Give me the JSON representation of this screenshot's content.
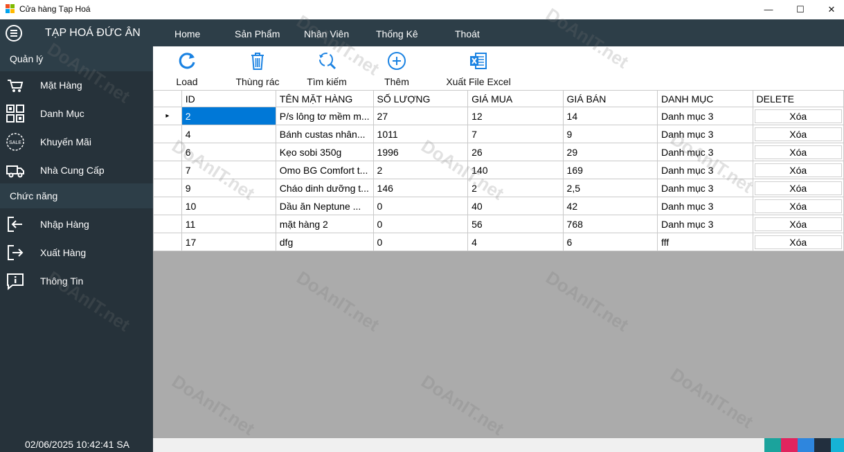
{
  "window": {
    "title": "Cửa hàng Tạp Hoá",
    "minimize_glyph": "—",
    "maximize_glyph": "☐",
    "close_glyph": "✕"
  },
  "header": {
    "brand": "TẠP HOÁ ĐỨC ÂN",
    "nav": [
      "Home",
      "Sản Phẩm",
      "Nhân Viên",
      "Thống Kê",
      "Thoát"
    ]
  },
  "sidebar": {
    "section_manage": "Quản lý",
    "manage_items": [
      {
        "label": "Mặt Hàng",
        "icon": "cart-icon"
      },
      {
        "label": "Danh Mục",
        "icon": "grid-icon"
      },
      {
        "label": "Khuyến Mãi",
        "icon": "sale-icon"
      },
      {
        "label": "Nhà Cung Cấp",
        "icon": "truck-icon"
      }
    ],
    "section_functions": "Chức năng",
    "function_items": [
      {
        "label": "Nhập Hàng",
        "icon": "import-icon"
      },
      {
        "label": "Xuất Hàng",
        "icon": "export-icon"
      },
      {
        "label": "Thông Tin",
        "icon": "info-icon"
      }
    ],
    "sale_badge": "SALE",
    "datetime": "02/06/2025 10:42:41 SA"
  },
  "toolbar": {
    "load": "Load",
    "trash": "Thùng rác",
    "search": "Tìm kiếm",
    "add": "Thêm",
    "export_excel": "Xuất File Excel"
  },
  "table": {
    "columns": [
      "ID",
      "TÊN MẶT HÀNG",
      "SỐ LƯỢNG",
      "GIÁ MUA",
      "GIÁ BÁN",
      "DANH MỤC",
      "DELETE"
    ],
    "delete_label": "Xóa",
    "current_row_marker": "▸",
    "rows": [
      {
        "id": "2",
        "name": "P/s lông tơ mềm m...",
        "qty": "27",
        "buy": "12",
        "sell": "14",
        "category": "Danh mục 3"
      },
      {
        "id": "4",
        "name": "Bánh custas nhân...",
        "qty": "1011",
        "buy": "7",
        "sell": "9",
        "category": "Danh mục 3"
      },
      {
        "id": "6",
        "name": "Kẹo sobi 350g",
        "qty": "1996",
        "buy": "26",
        "sell": "29",
        "category": "Danh mục 3"
      },
      {
        "id": "7",
        "name": "Omo BG Comfort t...",
        "qty": "2",
        "buy": "140",
        "sell": "169",
        "category": "Danh mục 3"
      },
      {
        "id": "9",
        "name": "Cháo dinh dưỡng t...",
        "qty": "146",
        "buy": "2",
        "sell": "2,5",
        "category": "Danh mục 3"
      },
      {
        "id": "10",
        "name": "Dầu ăn Neptune ...",
        "qty": "0",
        "buy": "40",
        "sell": "42",
        "category": "Danh mục 3"
      },
      {
        "id": "11",
        "name": "mặt hàng 2",
        "qty": "0",
        "buy": "56",
        "sell": "768",
        "category": "Danh mục 3"
      },
      {
        "id": "17",
        "name": "dfg",
        "qty": "0",
        "buy": "4",
        "sell": "6",
        "category": "fff"
      }
    ]
  },
  "status_colors": [
    "#1ba39c",
    "#e0245e",
    "#2e86de",
    "#222f3e",
    "#16b3d6"
  ],
  "watermark": "DoAnIT.net",
  "colors": {
    "header": "#2d3e48",
    "sidebar": "#26323a",
    "accent_blue": "#1a82e2",
    "selection": "#0078d7"
  }
}
